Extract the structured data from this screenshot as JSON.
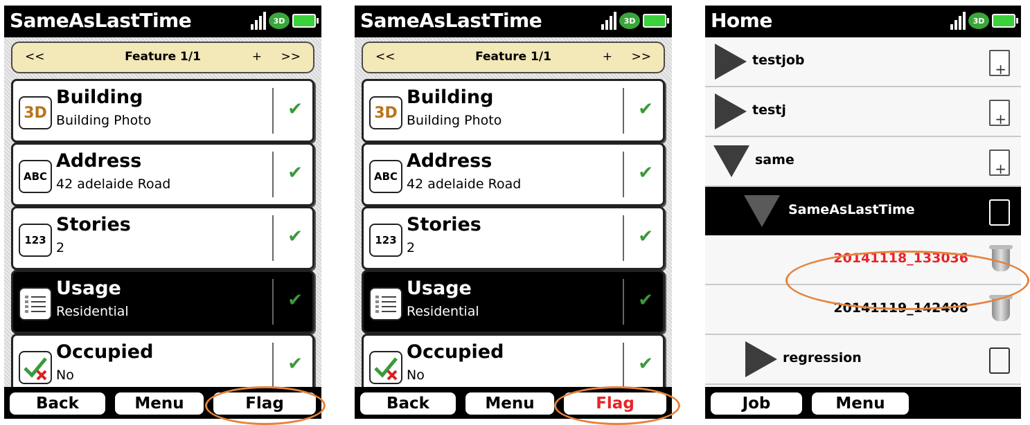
{
  "screens": [
    {
      "title": "SameAsLastTime",
      "feature_bar": {
        "prev": "<<",
        "title": "Feature 1/1",
        "add": "+",
        "next": ">>"
      },
      "fields": [
        {
          "icon": "3D",
          "name": "Building",
          "value": "Building Photo"
        },
        {
          "icon": "ABC",
          "name": "Address",
          "value": "42 adelaide Road"
        },
        {
          "icon": "123",
          "name": "Stories",
          "value": "2"
        },
        {
          "icon": "list",
          "name": "Usage",
          "value": "Residential"
        },
        {
          "icon": "check-x",
          "name": "Occupied",
          "value": "No"
        }
      ],
      "check": "✔",
      "buttons": {
        "back": "Back",
        "menu": "Menu",
        "flag": "Flag"
      },
      "flag_color": "#000000"
    },
    {
      "title": "SameAsLastTime",
      "feature_bar": {
        "prev": "<<",
        "title": "Feature 1/1",
        "add": "+",
        "next": ">>"
      },
      "fields": [
        {
          "icon": "3D",
          "name": "Building",
          "value": "Building Photo"
        },
        {
          "icon": "ABC",
          "name": "Address",
          "value": "42 adelaide Road"
        },
        {
          "icon": "123",
          "name": "Stories",
          "value": "2"
        },
        {
          "icon": "list",
          "name": "Usage",
          "value": "Residential"
        },
        {
          "icon": "check-x",
          "name": "Occupied",
          "value": "No"
        }
      ],
      "check": "✔",
      "buttons": {
        "back": "Back",
        "menu": "Menu",
        "flag": "Flag"
      },
      "flag_color": "#e8232a"
    }
  ],
  "home": {
    "title": "Home",
    "rows": [
      {
        "label": "testjob",
        "icon": "new-doc-icon"
      },
      {
        "label": "testj",
        "icon": "new-doc-icon"
      },
      {
        "label": "same",
        "icon": "new-doc-icon"
      },
      {
        "label": "SameAsLastTime",
        "icon": "copy-icon"
      },
      {
        "label": "20141118_133036",
        "icon": "trash-icon",
        "color": "#e8232a"
      },
      {
        "label": "20141119_142408",
        "icon": "trash-icon"
      },
      {
        "label": "regression",
        "icon": "copy-icon"
      }
    ],
    "buttons": {
      "job": "Job",
      "menu": "Menu"
    }
  },
  "colors": {
    "highlight_circle": "#e5823c",
    "accent_red": "#e8232a",
    "feature_bar": "#f2e8b8"
  }
}
